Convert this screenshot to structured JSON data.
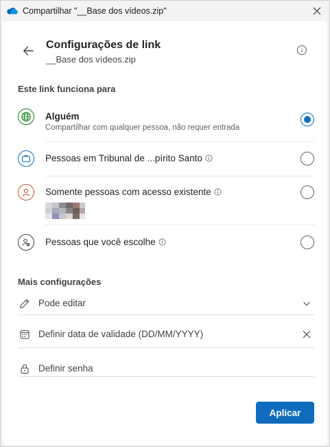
{
  "window": {
    "title": "Compartilhar \"__Base dos vídeos.zip\""
  },
  "header": {
    "title": "Configurações de link",
    "subtitle": "__Base dos vídeos.zip"
  },
  "link_works_for": {
    "heading": "Este link funciona para",
    "options": [
      {
        "label": "Alguém",
        "description": "Compartilhar com qualquer pessoa, não requer entrada",
        "icon": "globe-icon",
        "selected": true
      },
      {
        "label": "Pessoas em Tribunal de ...pírito Santo",
        "icon": "briefcase-icon",
        "selected": false,
        "has_info": true
      },
      {
        "label": "Somente pessoas com acesso existente",
        "icon": "person-icon",
        "selected": false,
        "has_info": true
      },
      {
        "label": "Pessoas que você escolhe",
        "icon": "person-settings-icon",
        "selected": false,
        "has_info": true
      }
    ]
  },
  "more_settings": {
    "heading": "Mais configurações",
    "permission": "Pode editar",
    "expiration_placeholder": "Definir data de validade (DD/MM/YYYY)",
    "password_placeholder": "Definir senha"
  },
  "actions": {
    "apply": "Aplicar"
  },
  "colors": {
    "accent": "#0f6cbd",
    "globe": "#107c10",
    "briefcase": "#0f6cbd",
    "person": "#c4522e"
  }
}
